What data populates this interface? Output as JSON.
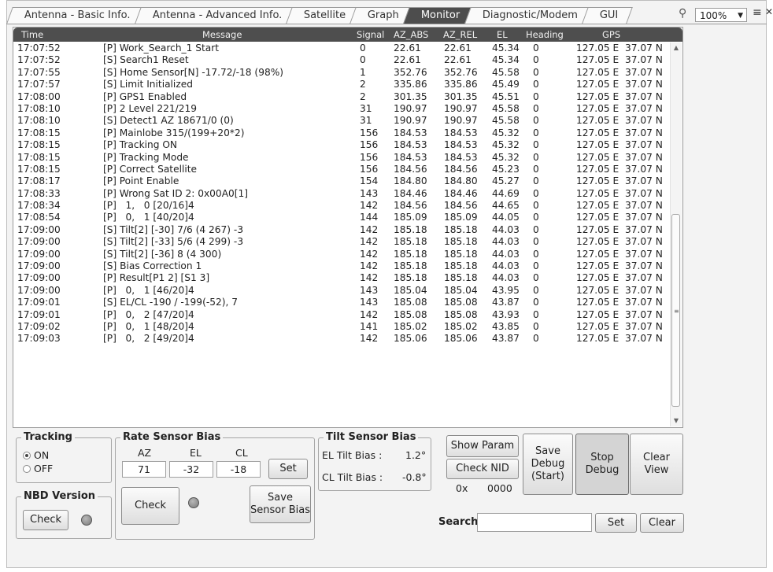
{
  "tabs": [
    {
      "label": "Antenna - Basic Info.",
      "active": false
    },
    {
      "label": "Antenna - Advanced Info.",
      "active": false
    },
    {
      "label": "Satellite",
      "active": false
    },
    {
      "label": "Graph",
      "active": false
    },
    {
      "label": "Monitor",
      "active": true
    },
    {
      "label": "Diagnostic/Modem",
      "active": false
    },
    {
      "label": "GUI",
      "active": false
    }
  ],
  "zoom": "100%",
  "grid": {
    "headers": {
      "time": "Time",
      "message": "Message",
      "signal": "Signal",
      "az_abs": "AZ_ABS",
      "az_rel": "AZ_REL",
      "el": "EL",
      "heading": "Heading",
      "gps": "GPS"
    },
    "rows": [
      [
        "17:07:52",
        "[P] Work_Search_1 Start",
        "0",
        "22.61",
        "22.61",
        "45.34",
        "0",
        "127.05 E  37.07 N"
      ],
      [
        "17:07:52",
        "[S] Search1 Reset",
        "0",
        "22.61",
        "22.61",
        "45.34",
        "0",
        "127.05 E  37.07 N"
      ],
      [
        "17:07:55",
        "[S] Home Sensor[N] -17.72/-18 (98%)",
        "1",
        "352.76",
        "352.76",
        "45.58",
        "0",
        "127.05 E  37.07 N"
      ],
      [
        "17:07:57",
        "[S] Limit Initialized",
        "2",
        "335.86",
        "335.86",
        "45.49",
        "0",
        "127.05 E  37.07 N"
      ],
      [
        "17:08:00",
        "[P] GPS1 Enabled",
        "2",
        "301.35",
        "301.35",
        "45.51",
        "0",
        "127.05 E  37.07 N"
      ],
      [
        "17:08:10",
        "[P] 2 Level 221/219",
        "31",
        "190.97",
        "190.97",
        "45.58",
        "0",
        "127.05 E  37.07 N"
      ],
      [
        "17:08:10",
        "[S] Detect1 AZ 18671/0 (0)",
        "31",
        "190.97",
        "190.97",
        "45.58",
        "0",
        "127.05 E  37.07 N"
      ],
      [
        "17:08:15",
        "[P] Mainlobe 315/(199+20*2)",
        "156",
        "184.53",
        "184.53",
        "45.32",
        "0",
        "127.05 E  37.07 N"
      ],
      [
        "17:08:15",
        "[P] Tracking ON",
        "156",
        "184.53",
        "184.53",
        "45.32",
        "0",
        "127.05 E  37.07 N"
      ],
      [
        "17:08:15",
        "[P] Tracking Mode",
        "156",
        "184.53",
        "184.53",
        "45.32",
        "0",
        "127.05 E  37.07 N"
      ],
      [
        "17:08:15",
        "[P] Correct Satellite",
        "156",
        "184.56",
        "184.56",
        "45.23",
        "0",
        "127.05 E  37.07 N"
      ],
      [
        "17:08:17",
        "[P] Point Enable",
        "154",
        "184.80",
        "184.80",
        "45.27",
        "0",
        "127.05 E  37.07 N"
      ],
      [
        "17:08:33",
        "[P] Wrong Sat ID 2: 0x00A0[1]",
        "143",
        "184.46",
        "184.46",
        "44.69",
        "0",
        "127.05 E  37.07 N"
      ],
      [
        "17:08:34",
        "[P]   1,   0 [20/16]4",
        "142",
        "184.56",
        "184.56",
        "44.65",
        "0",
        "127.05 E  37.07 N"
      ],
      [
        "17:08:54",
        "[P]   0,   1 [40/20]4",
        "144",
        "185.09",
        "185.09",
        "44.05",
        "0",
        "127.05 E  37.07 N"
      ],
      [
        "17:09:00",
        "[S] Tilt[2] [-30] 7/6 (4 267) -3",
        "142",
        "185.18",
        "185.18",
        "44.03",
        "0",
        "127.05 E  37.07 N"
      ],
      [
        "17:09:00",
        "[S] Tilt[2] [-33] 5/6 (4 299) -3",
        "142",
        "185.18",
        "185.18",
        "44.03",
        "0",
        "127.05 E  37.07 N"
      ],
      [
        "17:09:00",
        "[S] Tilt[2] [-36] 8 (4 300)",
        "142",
        "185.18",
        "185.18",
        "44.03",
        "0",
        "127.05 E  37.07 N"
      ],
      [
        "17:09:00",
        "[S] Bias Correction 1",
        "142",
        "185.18",
        "185.18",
        "44.03",
        "0",
        "127.05 E  37.07 N"
      ],
      [
        "17:09:00",
        "[P] Result[P1 2] [S1 3]",
        "142",
        "185.18",
        "185.18",
        "44.03",
        "0",
        "127.05 E  37.07 N"
      ],
      [
        "17:09:00",
        "[P]   0,   1 [46/20]4",
        "143",
        "185.04",
        "185.04",
        "43.95",
        "0",
        "127.05 E  37.07 N"
      ],
      [
        "17:09:01",
        "[S] EL/CL -190 / -199(-52), 7",
        "143",
        "185.08",
        "185.08",
        "43.87",
        "0",
        "127.05 E  37.07 N"
      ],
      [
        "17:09:01",
        "[P]   0,   2 [47/20]4",
        "142",
        "185.08",
        "185.08",
        "43.93",
        "0",
        "127.05 E  37.07 N"
      ],
      [
        "17:09:02",
        "[P]   0,   1 [48/20]4",
        "141",
        "185.02",
        "185.02",
        "43.85",
        "0",
        "127.05 E  37.07 N"
      ],
      [
        "17:09:03",
        "[P]   0,   2 [49/20]4",
        "142",
        "185.06",
        "185.06",
        "43.87",
        "0",
        "127.05 E  37.07 N"
      ]
    ]
  },
  "tracking": {
    "title": "Tracking",
    "on_label": "ON",
    "off_label": "OFF",
    "selected": "ON"
  },
  "nbd": {
    "title": "NBD Version",
    "check_label": "Check"
  },
  "rate_sensor": {
    "title": "Rate Sensor Bias",
    "az_label": "AZ",
    "el_label": "EL",
    "cl_label": "CL",
    "az_value": "71",
    "el_value": "-32",
    "cl_value": "-18",
    "set_label": "Set",
    "check_label": "Check",
    "save_label_1": "Save",
    "save_label_2": "Sensor Bias"
  },
  "tilt_sensor": {
    "title": "Tilt Sensor Bias",
    "el_label": "EL Tilt Bias :",
    "el_value": "1.2°",
    "cl_label": "CL Tilt Bias :",
    "cl_value": "-0.8°"
  },
  "buttons": {
    "show_param": "Show Param",
    "check_nid": "Check NID",
    "nid_prefix": "0x",
    "nid_value": "0000",
    "save_debug_1": "Save",
    "save_debug_2": "Debug",
    "save_debug_3": "(Start)",
    "stop_debug_1": "Stop",
    "stop_debug_2": "Debug",
    "clear_view_1": "Clear",
    "clear_view_2": "View"
  },
  "search": {
    "label": "Search",
    "value": "",
    "set_label": "Set",
    "clear_label": "Clear"
  }
}
